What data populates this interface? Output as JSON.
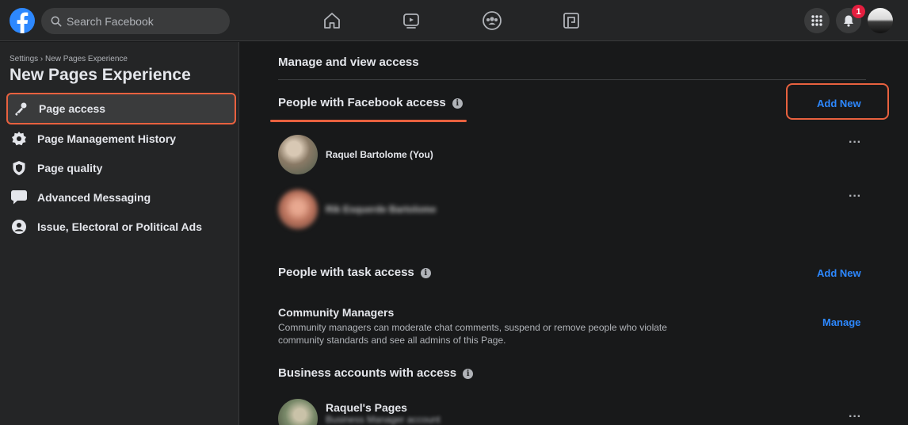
{
  "topbar": {
    "search_placeholder": "Search Facebook",
    "notification_count": "1",
    "icons": [
      "facebook-logo",
      "search-icon",
      "home-icon",
      "watch-icon",
      "groups-icon",
      "gaming-icon",
      "menu-grid-icon",
      "bell-icon"
    ]
  },
  "sidebar": {
    "breadcrumb": "Settings › New Pages Experience",
    "title": "New Pages Experience",
    "items": [
      {
        "label": "Page access",
        "icon": "key-icon",
        "active": true
      },
      {
        "label": "Page Management History",
        "icon": "gear-icon"
      },
      {
        "label": "Page quality",
        "icon": "shield-icon"
      },
      {
        "label": "Advanced Messaging",
        "icon": "chat-bubble-icon"
      },
      {
        "label": "Issue, Electoral or Political Ads",
        "icon": "person-circle-icon"
      }
    ]
  },
  "main": {
    "header": "Manage and view access",
    "facebook_access": {
      "title": "People with Facebook access",
      "add_label": "Add New",
      "people": [
        {
          "name": "Raquel Bartolome (You)"
        },
        {
          "name": "Rik Esquerde Bartolome"
        }
      ]
    },
    "task_access": {
      "title": "People with task access",
      "add_label": "Add New",
      "community_managers": {
        "title": "Community Managers",
        "description": "Community managers can moderate chat comments, suspend or remove people who violate community standards and see all admins of this Page.",
        "manage_label": "Manage"
      }
    },
    "business_access": {
      "title": "Business accounts with access",
      "accounts": [
        {
          "name": "Raquel's Pages",
          "sub": "Business Manager account"
        }
      ]
    },
    "more_label": "···"
  },
  "colors": {
    "accent_blue": "#2d88ff",
    "highlight_orange": "#e8613f",
    "badge_red": "#e41e3f",
    "background": "#18191a",
    "panel": "#242526"
  }
}
